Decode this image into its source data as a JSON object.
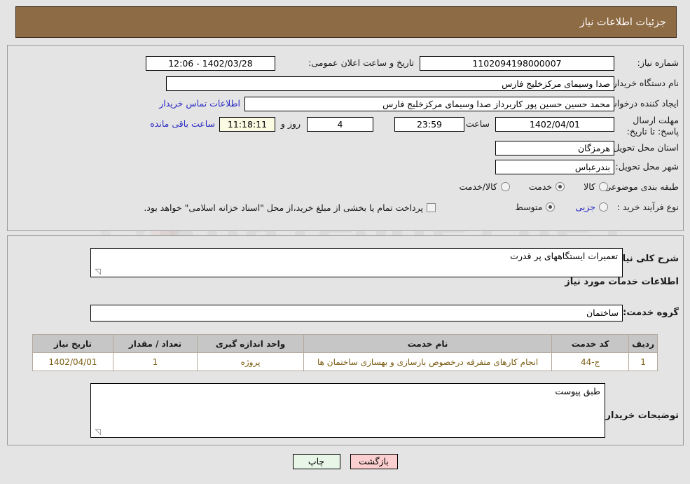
{
  "header": {
    "title": "جزئیات اطلاعات نیاز"
  },
  "form": {
    "need_number_label": "شماره نیاز:",
    "need_number_value": "1102094198000007",
    "public_announce_label": "تاریخ و ساعت اعلان عمومی:",
    "public_announce_value": "1402/03/28 - 12:06",
    "buyer_org_label": "نام دستگاه خریدار:",
    "buyer_org_value": "صدا وسیمای مرکزخلیج فارس",
    "creator_label": "ایجاد کننده درخواست:",
    "creator_value": "محمد حسین حسین پور کاربرداز صدا وسیمای مرکزخلیج فارس",
    "contact_link": "اطلاعات تماس خریدار",
    "deadline_label": "مهلت ارسال پاسخ: تا تاریخ:",
    "deadline_date": "1402/04/01",
    "hour_label": "ساعت",
    "deadline_time": "23:59",
    "days_value": "4",
    "days_label": "روز و",
    "countdown_value": "11:18:11",
    "remaining_label": "ساعت باقی مانده",
    "province_label": "استان محل تحویل:",
    "province_value": "هرمزگان",
    "city_label": "شهر محل تحویل:",
    "city_value": "بندرعباس",
    "category_label": "طبقه بندی موضوعی:",
    "category_options": [
      "کالا",
      "خدمت",
      "کالا/خدمت"
    ],
    "category_selected": "خدمت",
    "process_label": "نوع فرآیند خرید :",
    "process_options": [
      "جزیی",
      "متوسط"
    ],
    "process_selected": "متوسط",
    "treasury_note": "پرداخت تمام یا بخشی از مبلغ خرید،از محل \"اسناد خزانه اسلامی\" خواهد بود."
  },
  "description": {
    "general_need_label": "شرح کلی نیاز:",
    "general_need_value": "تعمیرات ایستگاههای پر قدرت",
    "services_heading": "اطلاعات خدمات مورد نیاز",
    "service_group_label": "گروه خدمت:",
    "service_group_value": "ساختمان",
    "buyer_notes_label": "توضیحات خریدار:",
    "buyer_notes_value": "طبق پیوست"
  },
  "table": {
    "headers": [
      "ردیف",
      "کد خدمت",
      "نام خدمت",
      "واحد اندازه گیری",
      "تعداد / مقدار",
      "تاریخ نیاز"
    ],
    "rows": [
      {
        "index": "1",
        "code": "ج-44",
        "name": "انجام کارهای متفرقه درخصوص بازسازی و بهسازی ساختمان ها",
        "unit": "پروژه",
        "quantity": "1",
        "date": "1402/04/01"
      }
    ]
  },
  "buttons": {
    "print": "چاپ",
    "back": "بازگشت"
  },
  "colors": {
    "header_bg": "#8d6b45",
    "page_bg": "#e4e4e4",
    "link": "#2b2bc4",
    "table_header_bg": "#c6c6c6",
    "table_value": "#7a5c12",
    "btn_print_bg": "#e8f6e8",
    "btn_back_bg": "#fbcfcf"
  }
}
